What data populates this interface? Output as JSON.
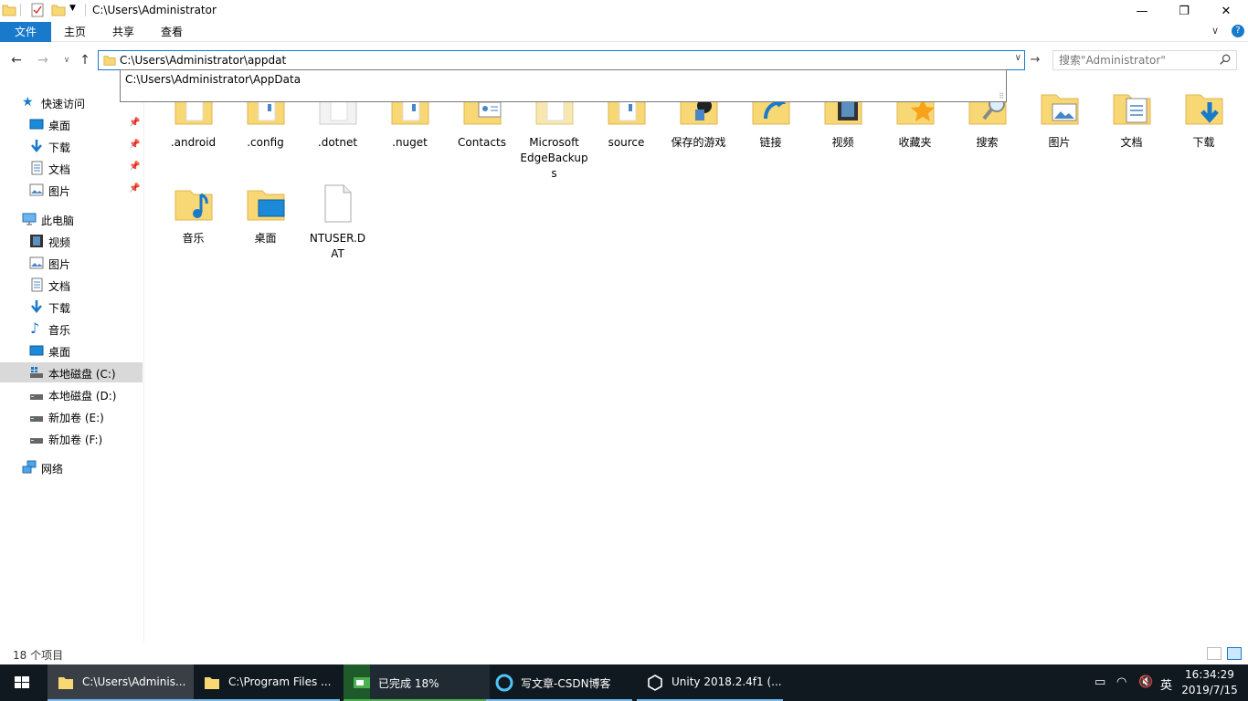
{
  "window": {
    "title": "C:\\Users\\Administrator",
    "controls": {
      "minimize": "—",
      "maximize": "❐",
      "close": "✕"
    }
  },
  "ribbon": {
    "tabs": [
      "文件",
      "主页",
      "共享",
      "查看"
    ]
  },
  "nav": {
    "address_value": "C:\\Users\\Administrator\\appdat",
    "search_placeholder": "搜索\"Administrator\"",
    "autocomplete": [
      "C:\\Users\\Administrator\\AppData"
    ]
  },
  "sidebar": {
    "quick_access": "快速访问",
    "quick_items": [
      "桌面",
      "下载",
      "文档",
      "图片"
    ],
    "this_pc": "此电脑",
    "pc_items": [
      "视频",
      "图片",
      "文档",
      "下载",
      "音乐",
      "桌面",
      "本地磁盘 (C:)",
      "本地磁盘 (D:)",
      "新加卷 (E:)",
      "新加卷 (F:)"
    ],
    "network": "网络"
  },
  "files": [
    {
      "name": ".android",
      "icon": "folder-icon"
    },
    {
      "name": ".config",
      "icon": "folder-icon"
    },
    {
      "name": ".dotnet",
      "icon": "folder-icon"
    },
    {
      "name": ".nuget",
      "icon": "folder-icon"
    },
    {
      "name": "Contacts",
      "icon": "contacts-folder-icon"
    },
    {
      "name": "Microsoft EdgeBackups",
      "icon": "folder-icon"
    },
    {
      "name": "source",
      "icon": "folder-icon"
    },
    {
      "name": "保存的游戏",
      "icon": "saved-games-folder-icon"
    },
    {
      "name": "链接",
      "icon": "links-folder-icon"
    },
    {
      "name": "视频",
      "icon": "videos-folder-icon"
    },
    {
      "name": "收藏夹",
      "icon": "favorites-folder-icon"
    },
    {
      "name": "搜索",
      "icon": "searches-folder-icon"
    },
    {
      "name": "图片",
      "icon": "pictures-folder-icon"
    },
    {
      "name": "文档",
      "icon": "documents-folder-icon"
    },
    {
      "name": "下载",
      "icon": "downloads-folder-icon"
    },
    {
      "name": "音乐",
      "icon": "music-folder-icon"
    },
    {
      "name": "桌面",
      "icon": "desktop-folder-icon"
    },
    {
      "name": "NTUSER.DAT",
      "icon": "file-icon"
    }
  ],
  "status": {
    "count": "18 个项目"
  },
  "taskbar": {
    "tasks": [
      "C:\\Users\\Adminis...",
      "C:\\Program Files ...",
      "已完成 18%",
      "写文章-CSDN博客",
      "Unity 2018.2.4f1 (..."
    ],
    "download_progress": 0.18,
    "ime": "英",
    "time": "16:34:29",
    "date": "2019/7/15"
  },
  "colors": {
    "accent": "#1979ca",
    "folder": "#f8d775",
    "taskbar": "#101820"
  }
}
